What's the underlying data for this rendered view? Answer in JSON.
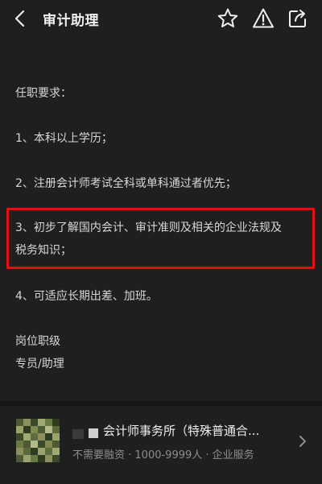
{
  "header": {
    "title": "审计助理",
    "icons": [
      "back-arrow-icon",
      "star-icon",
      "warning-icon",
      "share-icon"
    ]
  },
  "description": {
    "heading": "任职要求：",
    "req1": "1、本科以上学历；",
    "req2": "2、注册会计师考试全科或单科通过者优先；",
    "req3_line1": "3、初步了解国内会计、审计准则及相关的企业法规及",
    "req3_line2": "税务知识；",
    "req4": "4、可适应长期出差、加班。",
    "position_label": "岗位职级",
    "position_value": "专员/助理"
  },
  "company": {
    "name": "会计师事务所（特殊普通合...",
    "meta": "不需要融资 · 1000-9999人 · 企业服务"
  },
  "colors": {
    "background": "#1f1f1f",
    "text": "#d7d7d7",
    "highlight_border": "#e01010"
  }
}
